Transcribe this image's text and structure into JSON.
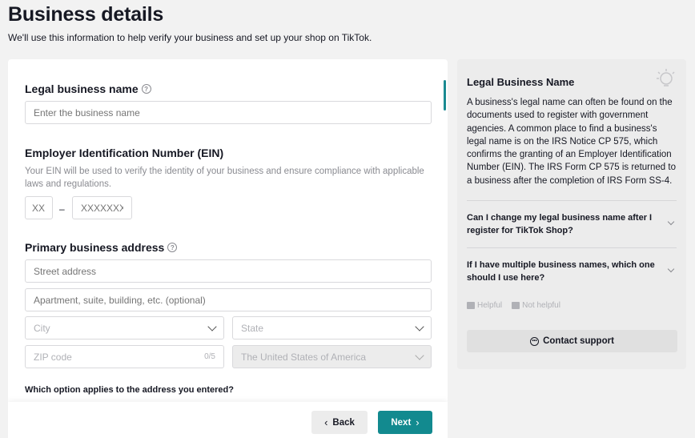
{
  "header": {
    "title": "Business details",
    "subtitle": "We'll use this information to help verify your business and set up your shop on TikTok."
  },
  "form": {
    "legal_name": {
      "label": "Legal business name",
      "placeholder": "Enter the business name"
    },
    "ein": {
      "label": "Employer Identification Number (EIN)",
      "help": "Your EIN will be used to verify the identity of your business and ensure compliance with applicable laws and regulations.",
      "part1_placeholder": "XX",
      "separator": "–",
      "part2_placeholder": "XXXXXXX"
    },
    "address": {
      "label": "Primary business address",
      "street_placeholder": "Street address",
      "apartment_placeholder": "Apartment, suite, building, etc. (optional)",
      "city_placeholder": "City",
      "state_placeholder": "State",
      "zip_placeholder": "ZIP code",
      "zip_counter": "0/5",
      "country_value": "The United States of America"
    },
    "address_option_question": "Which option applies to the address you entered?"
  },
  "footer": {
    "back_label": "Back",
    "next_label": "Next"
  },
  "sidebar": {
    "title": "Legal Business Name",
    "body": "A business's legal name can often be found on the documents used to register with government agencies. A common place to find a business's legal name is on the IRS Notice CP 575, which confirms the granting of an Employer Identification Number (EIN). The IRS Form CP 575 is returned to a business after the completion of IRS Form SS-4.",
    "faqs": [
      {
        "question": "Can I change my legal business name after I register for TikTok Shop?"
      },
      {
        "question": "If I have multiple business names, which one should I use here?"
      }
    ],
    "helpful_label": "Helpful",
    "not_helpful_label": "Not helpful",
    "contact_label": "Contact support"
  },
  "colors": {
    "accent": "#128a8f",
    "page_bg": "#f2f2f2",
    "sidebar_bg": "#ececec"
  }
}
